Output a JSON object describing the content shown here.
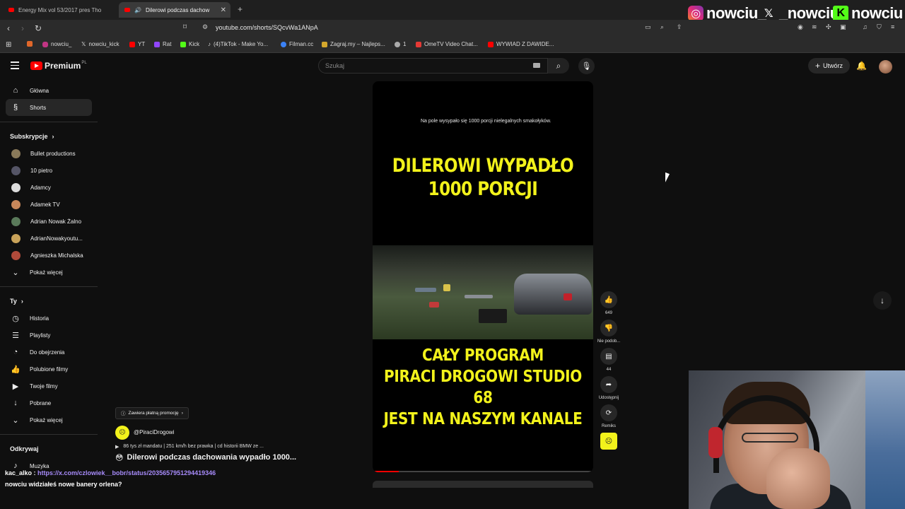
{
  "browser": {
    "tabs": [
      {
        "title": "Energy Mix vol 53/2017 pres Tho",
        "active": false
      },
      {
        "title": "Dilerowi podczas dachow",
        "active": true
      }
    ],
    "url": "youtube.com/shorts/SQcvWa1ANpA",
    "bookmarks": [
      "nowciu_",
      "nowciu_kick",
      "YT",
      "Rat",
      "Kick",
      "(4)TikTok - Make Yo...",
      "Filman.cc",
      "Zagraj.my – Najleps...",
      "1",
      "OmeTV Video Chat...",
      "WYWIAD Z DAWIDE..."
    ]
  },
  "overlay_social": {
    "instagram": "nowciu_",
    "x": "_nowciu",
    "kick": "nowciu"
  },
  "youtube": {
    "logo_text": "Premium",
    "region": "PL",
    "search_placeholder": "Szukaj",
    "create_label": "Utwórz"
  },
  "sidebar": {
    "main": [
      {
        "label": "Główna",
        "icon": "home-icon"
      },
      {
        "label": "Shorts",
        "icon": "shorts-icon",
        "active": true
      }
    ],
    "subs_header": "Subskrypcje",
    "subs": [
      "Bullet productions",
      "10 pietro",
      "Adamcy",
      "Adamek TV",
      "Adrian Nowak Żalno",
      "AdrianNowakyoutu...",
      "Agnieszka Michalska"
    ],
    "subs_more": "Pokaż więcej",
    "you_header": "Ty",
    "you": [
      {
        "label": "Historia",
        "icon": "history-icon"
      },
      {
        "label": "Playlisty",
        "icon": "playlist-icon"
      },
      {
        "label": "Do obejrzenia",
        "icon": "watch-later-icon"
      },
      {
        "label": "Polubione filmy",
        "icon": "like-icon"
      },
      {
        "label": "Twoje filmy",
        "icon": "your-videos-icon"
      },
      {
        "label": "Pobrane",
        "icon": "download-icon"
      }
    ],
    "you_more": "Pokaż więcej",
    "explore_header": "Odkrywaj",
    "explore": [
      {
        "label": "Muzyka",
        "icon": "music-icon"
      }
    ]
  },
  "short": {
    "caption": "Na pole wysypało się 1000 porcji nielegalnych smakołyków.",
    "headline_top": "DILEROWI WYPADŁO\n1000 PORCJI",
    "headline_bottom": "CAŁY PROGRAM\nPIRACI DROGOWI STUDIO 68\nJEST NA NASZYM KANALE",
    "progress": 0.12,
    "promo_label": "Zawiera płatną promocję",
    "channel": "@PiraciDrogowi",
    "description": "86 tys zł mandatu | 251 km/h bez prawka | cd historii BMW ze ...",
    "title": "Dilerowi podczas dachowania wypadło 1000..."
  },
  "actions": {
    "likes": "649",
    "dislike_label": "Nie podob...",
    "comments": "44",
    "share_label": "Udostępnij",
    "remix_label": "Remiks"
  },
  "chat": {
    "user": "kac_alko",
    "link": "https://x.com/czlowiek__bobr/status/2035657951294419346",
    "message2": "nowciu widziałeś nowe banery orlena?"
  }
}
